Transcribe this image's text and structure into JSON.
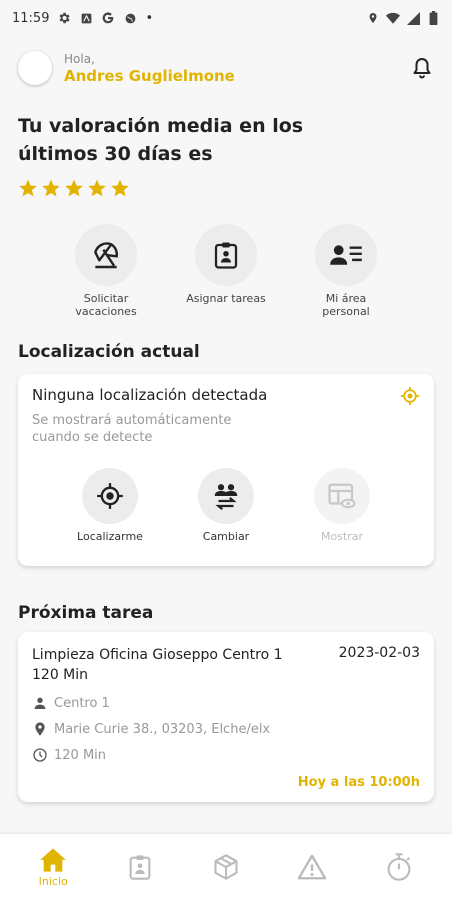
{
  "status_bar": {
    "time": "11:59",
    "dot": "•"
  },
  "header": {
    "greeting": "Hola,",
    "user_name": "Andres Guglielmone"
  },
  "rating": {
    "title": "Tu valoración media en los últimos 30 días es",
    "stars": 5
  },
  "quick_actions": [
    {
      "label": "Solicitar vacaciones",
      "icon": "umbrella-icon"
    },
    {
      "label": "Asignar tareas",
      "icon": "clipboard-user-icon"
    },
    {
      "label": "Mi área personal",
      "icon": "contact-card-icon"
    }
  ],
  "location": {
    "section_title": "Localización actual",
    "status": "Ninguna localización detectada",
    "hint": "Se mostrará automáticamente cuando se detecte",
    "actions": [
      {
        "label": "Localizarme",
        "icon": "crosshair-icon",
        "enabled": true
      },
      {
        "label": "Cambiar",
        "icon": "people-swap-icon",
        "enabled": true
      },
      {
        "label": "Mostrar",
        "icon": "map-view-icon",
        "enabled": false
      }
    ]
  },
  "next_task": {
    "section_title": "Próxima tarea",
    "name": "Limpieza Oficina Gioseppo Centro 1 120 Min",
    "date": "2023-02-03",
    "center": "Centro 1",
    "address": "Marie Curie 38., 03203, Elche/elx",
    "duration": "120 Min",
    "when": "Hoy a las 10:00h"
  },
  "bottom_nav": {
    "active_label": "Inicio",
    "items": [
      "home-icon",
      "clipboard-icon",
      "box-icon",
      "warning-icon",
      "stopwatch-icon"
    ]
  },
  "colors": {
    "accent": "#e0b400",
    "icon": "#222222",
    "muted": "#999999"
  }
}
